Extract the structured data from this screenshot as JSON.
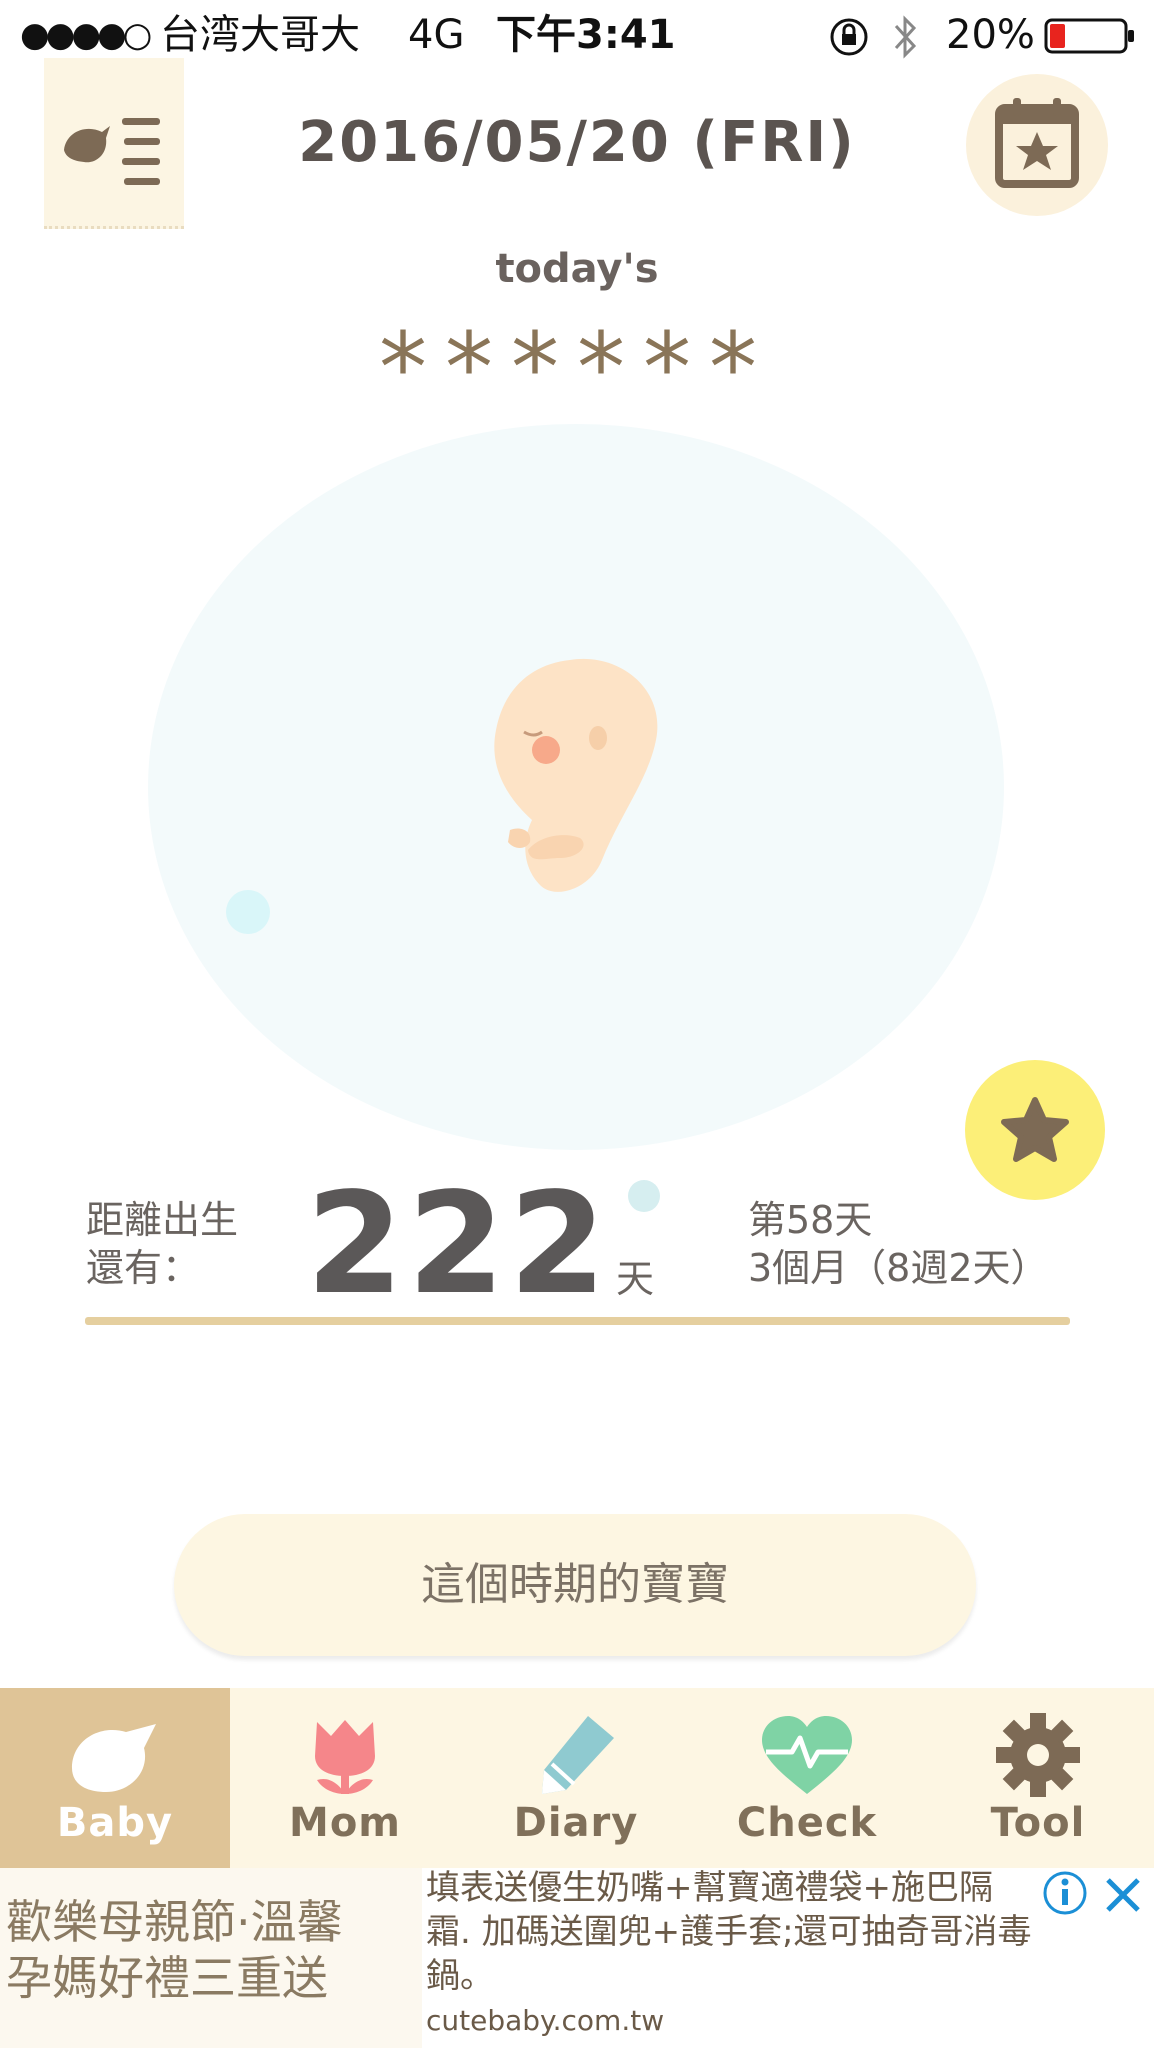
{
  "status_bar": {
    "signal": "●●●●○",
    "carrier": "台湾大哥大",
    "network": "4G",
    "time": "下午3:41",
    "battery": "20%"
  },
  "header": {
    "date": "2016/05/20 (FRI)"
  },
  "rating": {
    "label": "today's",
    "stars": "******"
  },
  "countdown": {
    "label_line1": "距離出生",
    "label_line2": "還有：",
    "days": "222",
    "unit": "天",
    "day_number": "第58天",
    "months": "3個月（8週2天）"
  },
  "period_button": {
    "label": "這個時期的寶寶"
  },
  "tabs": [
    {
      "label": "Baby",
      "icon": "bird-icon",
      "active": true
    },
    {
      "label": "Mom",
      "icon": "tulip-icon",
      "active": false
    },
    {
      "label": "Diary",
      "icon": "pencil-icon",
      "active": false
    },
    {
      "label": "Check",
      "icon": "heartbeat-icon",
      "active": false
    },
    {
      "label": "Tool",
      "icon": "gear-icon",
      "active": false
    }
  ],
  "ad": {
    "left_line1": "歡樂母親節·溫馨",
    "left_line2": "孕媽好禮三重送",
    "body": "填表送優生奶嘴+幫寶適禮袋+施巴隔\n霜. 加碼送圍兜+護手套;還可抽奇哥消毒\n鍋。",
    "url": "cutebaby.com.tw"
  },
  "colors": {
    "accent": "#dfc497",
    "star": "#8a7558",
    "favorite": "#fcef78",
    "rule": "#e5cf9f",
    "tabbar": "#fdf6e3"
  }
}
